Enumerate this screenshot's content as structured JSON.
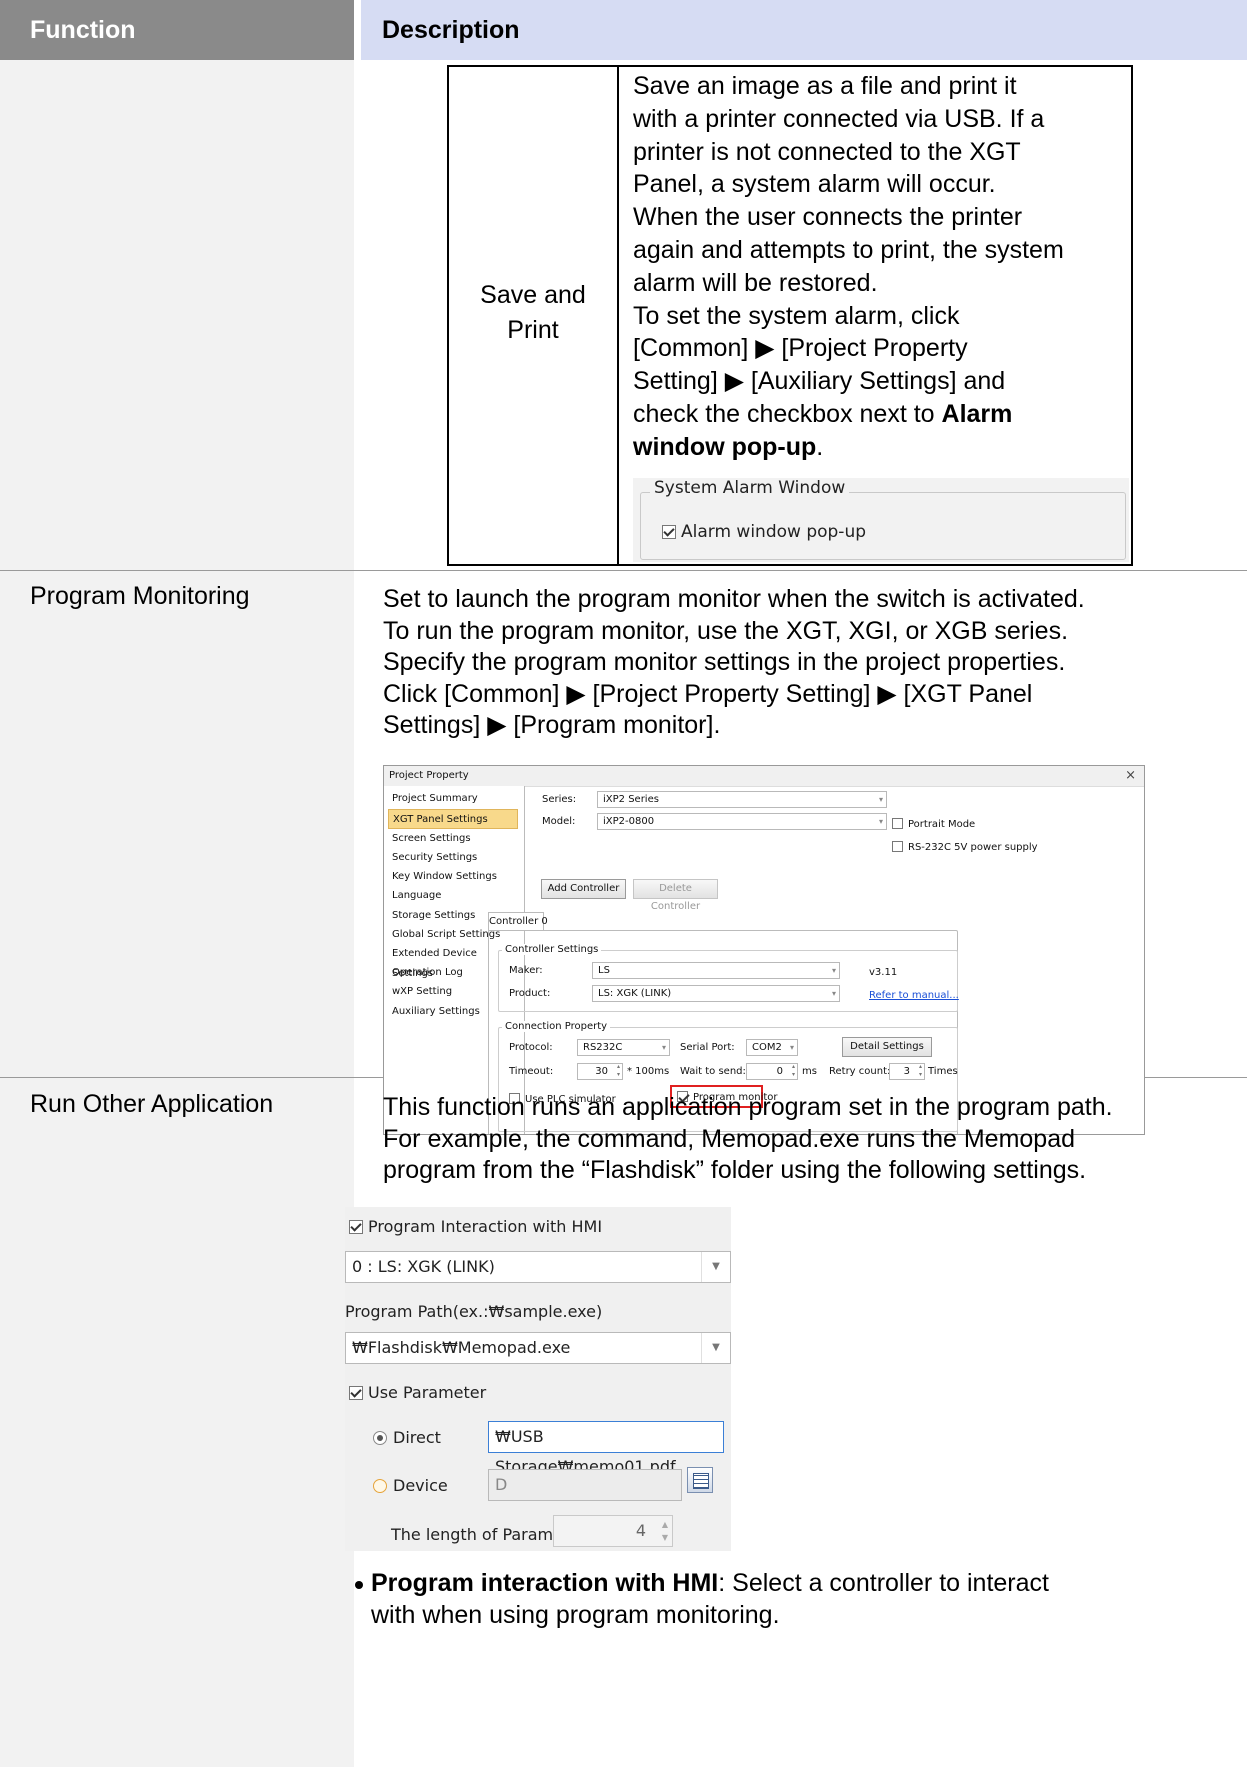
{
  "header": {
    "function": "Function",
    "description": "Description"
  },
  "save_print": {
    "label_line1": "Save and",
    "label_line2": "Print",
    "desc_lines": [
      "Save an image as a file and print it",
      "with a printer connected via USB. If a",
      "printer is not connected to the XGT",
      "Panel, a system alarm will occur.",
      "When the user connects the printer",
      "again and attempts to print, the system",
      "alarm will be restored.",
      "To set the system alarm, click",
      "[Common] ▶ [Project Property",
      "Setting] ▶ [Auxiliary Settings] and",
      "check the checkbox next to "
    ],
    "desc_bold_1": "Alarm",
    "desc_bold_2": "window pop-up",
    "desc_end": ".",
    "alarm_group_legend": "System Alarm Window",
    "alarm_checkbox_label": "Alarm window pop-up"
  },
  "program_monitoring": {
    "title": "Program Monitoring",
    "desc_lines": [
      "Set to launch the program monitor when the switch is activated.",
      "To run the program monitor, use the XGT, XGI, or XGB series.",
      "Specify the program monitor settings in the project properties.",
      "Click [Common] ▶ [Project Property Setting] ▶ [XGT Panel",
      "Settings] ▶ [Program monitor]."
    ],
    "window": {
      "title": "Project Property",
      "close": "×",
      "nav": [
        "Project Summary",
        "XGT Panel Settings",
        "Screen Settings",
        "Security Settings",
        "Key Window Settings",
        "Language",
        "Storage Settings",
        "Global Script Settings",
        "Extended Device Settings",
        "Operation Log",
        "wXP Setting",
        "Auxiliary Settings"
      ],
      "series_label": "Series:",
      "series_value": "iXP2 Series",
      "model_label": "Model:",
      "model_value": "iXP2-0800",
      "portrait_mode": "Portrait Mode",
      "rs232c": "RS-232C 5V power supply",
      "add_controller": "Add Controller",
      "delete_controller": "Delete Controller",
      "controller_tab": "Controller 0",
      "controller_settings": "Controller Settings",
      "maker_label": "Maker:",
      "maker_value": "LS",
      "version": "v3.11",
      "product_label": "Product:",
      "product_value": "LS: XGK (LINK)",
      "refer_manual": "Refer to manual...",
      "connection_property": "Connection Property",
      "protocol_label": "Protocol:",
      "protocol_value": "RS232C",
      "serial_port_label": "Serial Port:",
      "serial_port_value": "COM2",
      "detail_settings": "Detail Settings",
      "timeout_label": "Timeout:",
      "timeout_value": "30",
      "timeout_unit": "* 100ms",
      "wait_label": "Wait to send:",
      "wait_value": "0",
      "wait_unit": "ms",
      "retry_label": "Retry count:",
      "retry_value": "3",
      "retry_unit": "Times",
      "use_plc_sim": "Use PLC simulator",
      "program_monitor": "Program monitor"
    }
  },
  "run_other": {
    "title": "Run Other Application",
    "desc_lines": [
      "This function runs an application program set in the program path.",
      "For example, the command, Memopad.exe runs the Memopad",
      "program from the “Flashdisk” folder using the following settings."
    ],
    "widget": {
      "interaction_label": "Program Interaction with HMI",
      "controller_value": "0 : LS: XGK (LINK)",
      "path_label": "Program Path(ex.:₩sample.exe)",
      "path_value": "₩Flashdisk₩Memopad.exe",
      "use_parameter": "Use Parameter",
      "direct_label": "Direct",
      "direct_value": "₩USB Storage₩memo01.pdf",
      "device_label": "Device",
      "device_value": "D",
      "length_label": "The length of Param.",
      "length_value": "4"
    },
    "bullet_bold": "Program interaction with HMI",
    "bullet_text": ": Select a controller to interact",
    "bullet_line2": "with when using program monitoring."
  }
}
